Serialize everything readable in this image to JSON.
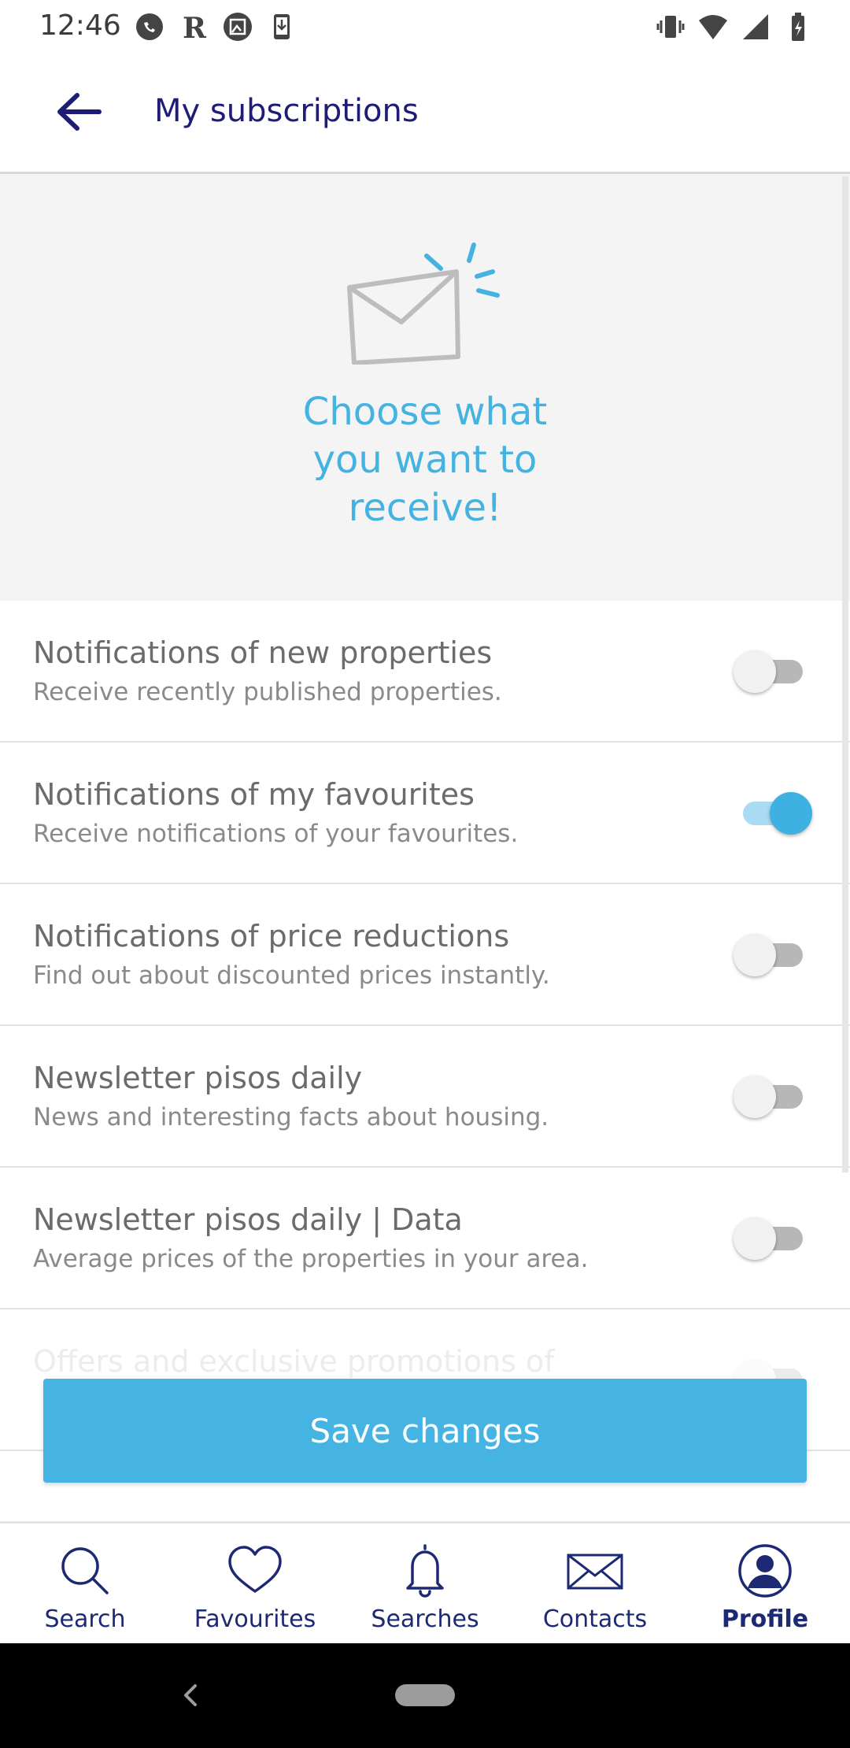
{
  "status_bar": {
    "time": "12:46",
    "left_icons": [
      "whatsapp-icon",
      "r-app-icon",
      "image-icon",
      "download-phone-icon"
    ],
    "right_icons": [
      "vibrate-icon",
      "wifi-icon",
      "signal-icon",
      "battery-charging-icon"
    ]
  },
  "header": {
    "title": "My subscriptions",
    "back_icon": "arrow-left-icon"
  },
  "hero": {
    "illustration": "envelope-icon",
    "line1": "Choose what",
    "line2": "you want to",
    "line3": "receive!"
  },
  "subscriptions": [
    {
      "title": "Notifications of new properties",
      "subtitle": "Receive recently published properties.",
      "enabled": false
    },
    {
      "title": "Notifications of my favourites",
      "subtitle": "Receive notifications of your favourites.",
      "enabled": true
    },
    {
      "title": "Notifications of price reductions",
      "subtitle": "Find out about discounted prices instantly.",
      "enabled": false
    },
    {
      "title": "Newsletter pisos daily",
      "subtitle": "News and interesting facts about housing.",
      "enabled": false
    },
    {
      "title": "Newsletter pisos daily | Data",
      "subtitle": "Average prices of the properties in your area.",
      "enabled": false
    },
    {
      "title": "Offers and exclusive promotions of",
      "subtitle": "",
      "enabled": false
    }
  ],
  "save_button": {
    "label": "Save changes"
  },
  "bottom_nav": [
    {
      "label": "Search",
      "icon": "search-icon",
      "active": false
    },
    {
      "label": "Favourites",
      "icon": "heart-icon",
      "active": false
    },
    {
      "label": "Searches",
      "icon": "bell-icon",
      "active": false
    },
    {
      "label": "Contacts",
      "icon": "mail-icon",
      "active": false
    },
    {
      "label": "Profile",
      "icon": "profile-icon",
      "active": true
    }
  ],
  "colors": {
    "accent": "#45b4e3",
    "nav_text": "#1d2a73",
    "hero_text": "#44b3e1",
    "hero_bg": "#f4f4f4"
  }
}
